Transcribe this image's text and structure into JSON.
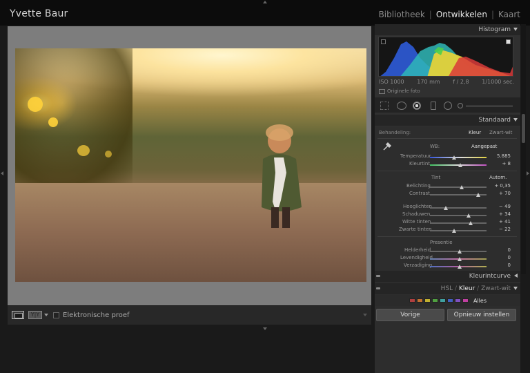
{
  "identity_plate": "Yvette Baur",
  "modules": [
    {
      "label": "Bibliotheek",
      "active": false
    },
    {
      "label": "Ontwikkelen",
      "active": true
    },
    {
      "label": "Kaart",
      "active": false
    }
  ],
  "toolbar": {
    "soft_proof_label": "Elektronische proef"
  },
  "histogram": {
    "title": "Histogram",
    "iso": "ISO 1000",
    "focal": "170 mm",
    "aperture": "f / 2,8",
    "shutter": "1/1000 sec.",
    "original_label": "Originele foto"
  },
  "basic": {
    "title": "Standaard",
    "treatment_label": "Behandeling:",
    "treatment_color": "Kleur",
    "treatment_bw": "Zwart-wit",
    "wb_label": "WB:",
    "wb_value": "Aangepast",
    "temp_label": "Temperatuur",
    "temp_value": "5.885",
    "tint_label": "Kleurtint",
    "tint_value": "+ 8",
    "tone_label": "Tint",
    "auto_label": "Autom.",
    "exposure_label": "Belichting",
    "exposure_value": "+ 0,35",
    "contrast_label": "Contrast",
    "contrast_value": "+ 70",
    "highlights_label": "Hooglichten",
    "highlights_value": "− 49",
    "shadows_label": "Schaduwen",
    "shadows_value": "+ 34",
    "whites_label": "Witte tinten",
    "whites_value": "+ 41",
    "blacks_label": "Zwarte tinten",
    "blacks_value": "− 22",
    "presence_label": "Presentie",
    "clarity_label": "Helderheid",
    "clarity_value": "0",
    "vibrance_label": "Levendigheid",
    "vibrance_value": "0",
    "saturation_label": "Verzadiging",
    "saturation_value": "0"
  },
  "tone_curve": {
    "title": "Kleurintcurve"
  },
  "hsl": {
    "tab_hsl": "HSL",
    "tab_color": "Kleur",
    "tab_bw": "Zwart-wit",
    "all_label": "Alles",
    "swatches": [
      "#b04040",
      "#c07030",
      "#c0b030",
      "#50a040",
      "#40a0a0",
      "#4060c0",
      "#8050c0",
      "#c040a0"
    ]
  },
  "buttons": {
    "previous": "Vorige",
    "reset": "Opnieuw instellen"
  }
}
